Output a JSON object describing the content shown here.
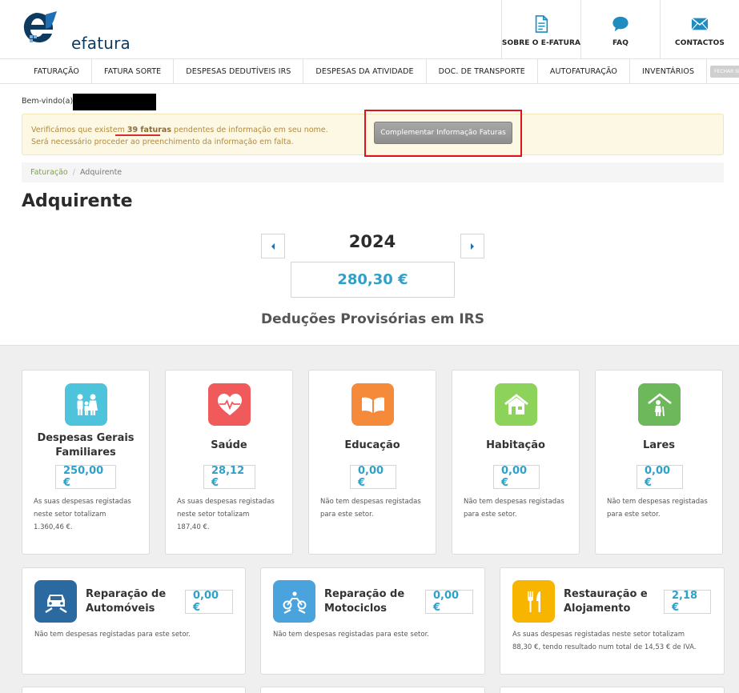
{
  "header": {
    "logo_text": "efatura",
    "nav": [
      {
        "label": "SOBRE O E-FATURA",
        "icon": "document-icon"
      },
      {
        "label": "FAQ",
        "icon": "chat-bubble-icon"
      },
      {
        "label": "CONTACTOS",
        "icon": "envelope-icon"
      }
    ]
  },
  "menu": {
    "items": [
      "FATURAÇÃO",
      "FATURA SORTE",
      "DESPESAS DEDUTÍVEIS IRS",
      "DESPESAS DA ATIVIDADE",
      "DOC. DE TRANSPORTE",
      "AUTOFATURAÇÃO",
      "INVENTÁRIOS"
    ],
    "logout_label": "FECHAR SESSÃO"
  },
  "welcome": {
    "label": "Bem-vindo(a)"
  },
  "alert": {
    "text_before": "Verificámos que existem ",
    "count_text": "39 faturas",
    "text_after": " pendentes de informação em seu nome.",
    "line2": "Será necessário proceder ao preenchimento da informação em falta.",
    "button_label": "Complementar Informação Faturas"
  },
  "breadcrumb": {
    "link": "Faturação",
    "separator": "/",
    "current": "Adquirente"
  },
  "page": {
    "title": "Adquirente",
    "year": "2024",
    "total": "280,30 €",
    "section_title": "Deduções Provisórias em IRS"
  },
  "colors": {
    "accent_blue": "#2ea1c8",
    "alert_bg": "#fcf8e3",
    "highlight_red": "#e0131a",
    "link_green": "#7aa63a"
  },
  "cards": [
    {
      "title_line1": "Despesas Gerais",
      "title_line2": "Familiares",
      "value": "250,00 €",
      "desc1": "As suas despesas registadas",
      "desc2": "neste setor totalizam",
      "desc3": "1.360,46 €.",
      "icon": "family-icon",
      "color": "#4ec3dc"
    },
    {
      "title_line1": "Saúde",
      "title_line2": "",
      "value": "28,12 €",
      "desc1": "As suas despesas registadas",
      "desc2": "neste setor totalizam",
      "desc3": "187,40 €.",
      "icon": "heart-icon",
      "color": "#f05a5a"
    },
    {
      "title_line1": "Educação",
      "title_line2": "",
      "value": "0,00 €",
      "desc1": "Não tem despesas registadas",
      "desc2": "para este setor.",
      "desc3": "",
      "icon": "book-icon",
      "color": "#f58a3a"
    },
    {
      "title_line1": "Habitação",
      "title_line2": "",
      "value": "0,00 €",
      "desc1": "Não tem despesas registadas",
      "desc2": "para este setor.",
      "desc3": "",
      "icon": "house-icon",
      "color": "#8dd25a"
    },
    {
      "title_line1": "Lares",
      "title_line2": "",
      "value": "0,00 €",
      "desc1": "Não tem despesas registadas",
      "desc2": "para este setor.",
      "desc3": "",
      "icon": "elderly-home-icon",
      "color": "#6cb85a"
    }
  ],
  "wide_cards": [
    {
      "title_line1": "Reparação de",
      "title_line2": "Automóveis",
      "value": "0,00 €",
      "desc1": "Não tem despesas registadas para este setor.",
      "desc2": "",
      "icon": "car-repair-icon",
      "color": "#2b6aa0"
    },
    {
      "title_line1": "Reparação de",
      "title_line2": "Motociclos",
      "value": "0,00 €",
      "desc1": "Não tem despesas registadas para este setor.",
      "desc2": "",
      "icon": "motorcycle-repair-icon",
      "color": "#4aa3dc"
    },
    {
      "title_line1": "Restauração e",
      "title_line2": "Alojamento",
      "value": "2,18 €",
      "desc1": "As suas despesas registadas neste setor totalizam",
      "desc2": "88,30 €, tendo resultado num total de 14,53 € de IVA.",
      "icon": "cutlery-icon",
      "color": "#f7b500"
    }
  ]
}
